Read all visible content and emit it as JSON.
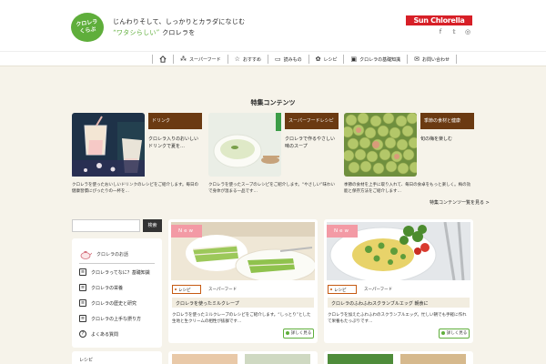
{
  "header": {
    "logo_line1": "クロレラ",
    "logo_line2": "くらぶ",
    "tagline_line1": "じんわりそして、しっかりとカラダになじむ",
    "tagline_quote": "“ワタシらしい”",
    "tagline_suffix": "クロレラを",
    "brand_logo": "Sun Chlorella"
  },
  "social": {
    "facebook": "f",
    "twitter": "𝕥",
    "instagram": "◎"
  },
  "nav": {
    "home_icon": "home-icon",
    "items": [
      {
        "icon": "⁂",
        "label": "スーパーフード"
      },
      {
        "icon": "☆",
        "label": "おすすめ"
      },
      {
        "icon": "▭",
        "label": "読みもの"
      },
      {
        "icon": "✿",
        "label": "レシピ"
      },
      {
        "icon": "▣",
        "label": "クロレラの基礎知識"
      },
      {
        "icon": "✉",
        "label": "お問い合わせ"
      }
    ]
  },
  "feature": {
    "heading": "特集コンテンツ",
    "items": [
      {
        "category": "ドリンク",
        "title": "クロレラ入りのおいしいドリンクで夏を…",
        "desc": "クロレラを使ったおいしいドリンクのレシピをご紹介します。毎日の健康習慣にぴったりの一杯を…"
      },
      {
        "category": "スーパーフードレシピ",
        "title": "クロレラで作るやさしい味のスープ",
        "desc": "クロレラを使ったスープのレシピをご紹介します。“やさしい”味わいで身体が温まる一品です…"
      },
      {
        "category": "季節の食材と健康",
        "title": "旬の梅を楽しむ",
        "desc": "季節の食材を上手に取り入れて、毎日の食卓をもっと楽しく。梅の効能と保存方法をご紹介します…"
      }
    ],
    "more_link": "特集コンテンツ一覧を見る >"
  },
  "search": {
    "placeholder": "",
    "button": "検索"
  },
  "sidebar": {
    "title": "クロレラのお話",
    "items": [
      "クロレラってなに？基礎知識",
      "クロレラの栄養",
      "クロレラの歴史と研究",
      "クロレラの上手な摂り方",
      "よくある質問"
    ],
    "next_title": "レシピ"
  },
  "articles": [
    {
      "badge": "New",
      "tag": "レシピ",
      "subtag": "スーパーフード",
      "title": "クロレラを使ったミルクレープ",
      "desc": "クロレラを使ったミルクレープのレシピをご紹介します。“しっとり”とした生地と生クリームの相性が抜群です…"
    },
    {
      "badge": "New",
      "tag": "レシピ",
      "subtag": "スーパーフード",
      "title": "クロレラのふわふわスクランブルエッグ 朝食に",
      "desc": "クロレラを加えたふわふわのスクランブルエッグ。忙しい朝でも手軽に作れて栄養もたっぷりです…"
    }
  ],
  "detail_label": "詳しく見る",
  "colors": {
    "brand_green": "#5fae3b",
    "category_brown": "#6b3a12",
    "new_pink": "#f39aa5",
    "brand_red": "#d71f27"
  }
}
